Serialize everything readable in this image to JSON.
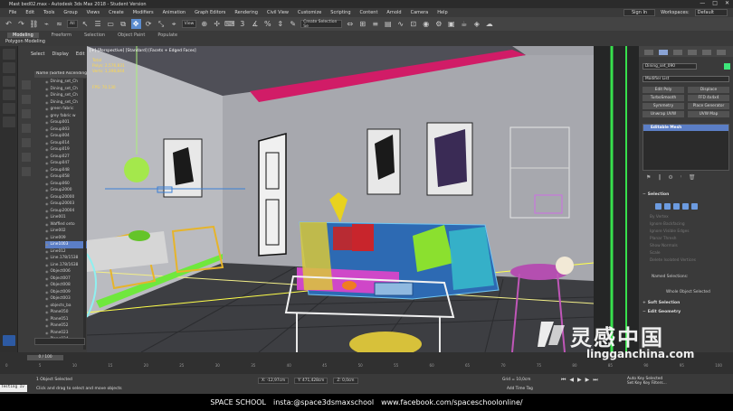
{
  "window": {
    "title": "Mast bed02.max - Autodesk 3ds Max 2018 - Student Version",
    "controls": [
      "—",
      "□",
      "✕"
    ]
  },
  "menu": {
    "items": [
      "File",
      "Edit",
      "Tools",
      "Group",
      "Views",
      "Create",
      "Modifiers",
      "Animation",
      "Graph Editors",
      "Rendering",
      "Civil View",
      "Customize",
      "Scripting",
      "Content",
      "Arnold",
      "Camera",
      "Help"
    ],
    "sign_in": "Sign In",
    "workspaces_label": "Workspaces:",
    "workspace_value": "Default"
  },
  "toolbar": {
    "filter_value": "All",
    "view_value": "View",
    "selection_set_placeholder": "Create Selection Se"
  },
  "ribbon": {
    "tabs": [
      "Modeling",
      "Freeform",
      "Selection",
      "Object Paint",
      "Populate"
    ],
    "active_tab": "Modeling",
    "sub_label": "Polygon Modeling"
  },
  "scene_explorer": {
    "tabs": [
      "Select",
      "Display",
      "Edit"
    ],
    "column_header": "Name (Sorted Ascending)",
    "rows": [
      "Dining_set_Ch",
      "Dining_set_Ch",
      "Dining_set_Ch",
      "Dining_set_Ch",
      "green fabric",
      "grey fabric w",
      "Group001",
      "Group003",
      "Group004",
      "Group014",
      "Group019",
      "Group027",
      "Group047",
      "Group048",
      "Group058",
      "Group060",
      "Group2000",
      "Group20000",
      "Group20003",
      "Group20004",
      "Line001",
      "Waffled onto",
      "Line002",
      "Line009",
      "Line1003",
      "Line012",
      "Line.178/1538",
      "Line.178/1638",
      "Object006",
      "Object007",
      "Object008",
      "Object009",
      "Object003",
      "objects_ba",
      "Plane050",
      "Plane051",
      "Plane052",
      "Plane023",
      "Plane024"
    ],
    "selected_index": 24
  },
  "viewport": {
    "label": "[+] [Perspective] [Standard] [Facets + Edged Faces]",
    "stats_labels": [
      "Total",
      "Polys:",
      "Verts:"
    ],
    "stats_values": [
      "",
      "2,576,831",
      "1,398,844"
    ],
    "fps": "FPS:",
    "fps_value": "70.130"
  },
  "command_panel": {
    "object_name": "Dining_set_090",
    "modifier_list": "Modifier List",
    "buttons": [
      "Edit Poly",
      "Displace",
      "TurboSmooth",
      "FFD 4x4x4",
      "Symmetry",
      "Place Generator",
      "Unwrap UVW",
      "UVW Map"
    ],
    "stack_item": "Editable Mesh",
    "stack_icons": [
      "⚑",
      "‖",
      "⚙",
      "ᵎ",
      "🗑"
    ],
    "selection_rollout": "Selection",
    "faint_options": [
      "By Vertex",
      "Ignore Backfacing",
      "Ignore Visible Edges",
      "Planar Thresh",
      "Show Normals",
      "Scale",
      "Delete Isolated Vertices"
    ],
    "named_selections": "Named Selections:",
    "whole_object": "Whole Object Selected",
    "soft_selection": "Soft Selection",
    "edit_geometry": "Edit Geometry"
  },
  "timeline": {
    "frame_display": "0 / 100",
    "ticks": [
      "0",
      "5",
      "10",
      "15",
      "20",
      "25",
      "30",
      "35",
      "40",
      "45",
      "50",
      "55",
      "60",
      "65",
      "70",
      "75",
      "80",
      "85",
      "90",
      "95",
      "100"
    ]
  },
  "status": {
    "script_text": "Testing Iv",
    "selection_text": "1 Object Selected",
    "hint_text": "Click and drag to select and move objects",
    "coords": [
      "X: -12,97cm",
      "Y: 471,428cm",
      "Z: 0,0cm"
    ],
    "grid": "Grid = 10,0cm",
    "add_time_tag": "Add Time Tag",
    "auto_key": "Auto Key",
    "selected": "Selected",
    "set_key": "Set Key",
    "key_filters": "Key Filters..."
  },
  "credits": {
    "brand": "SPACE SCHOOL",
    "insta": "insta:@space3dsmaxschool",
    "facebook": "www.facebook.com/spaceschoolonline/"
  },
  "watermark": {
    "chinese": "灵感中国",
    "url": "lingganchina.com"
  }
}
